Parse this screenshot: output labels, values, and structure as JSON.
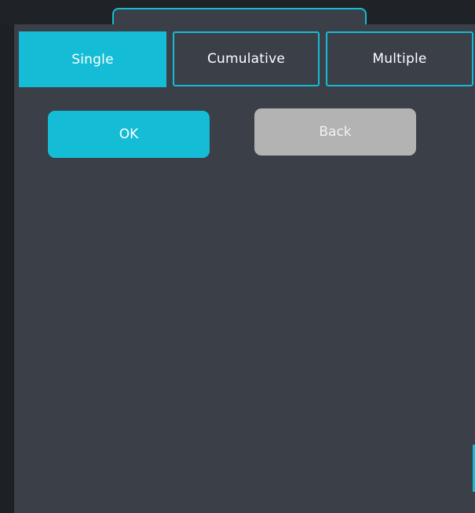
{
  "tabs": [
    {
      "label": "Single",
      "active": true
    },
    {
      "label": "Cumulative",
      "active": false
    },
    {
      "label": "Multiple",
      "active": false
    }
  ],
  "actions": {
    "ok_label": "OK",
    "back_label": "Back"
  },
  "colors": {
    "accent": "#15bcd6",
    "panel": "#3a3f48",
    "back_button": "#b3b3b3",
    "window_bg": "#1f2227"
  }
}
